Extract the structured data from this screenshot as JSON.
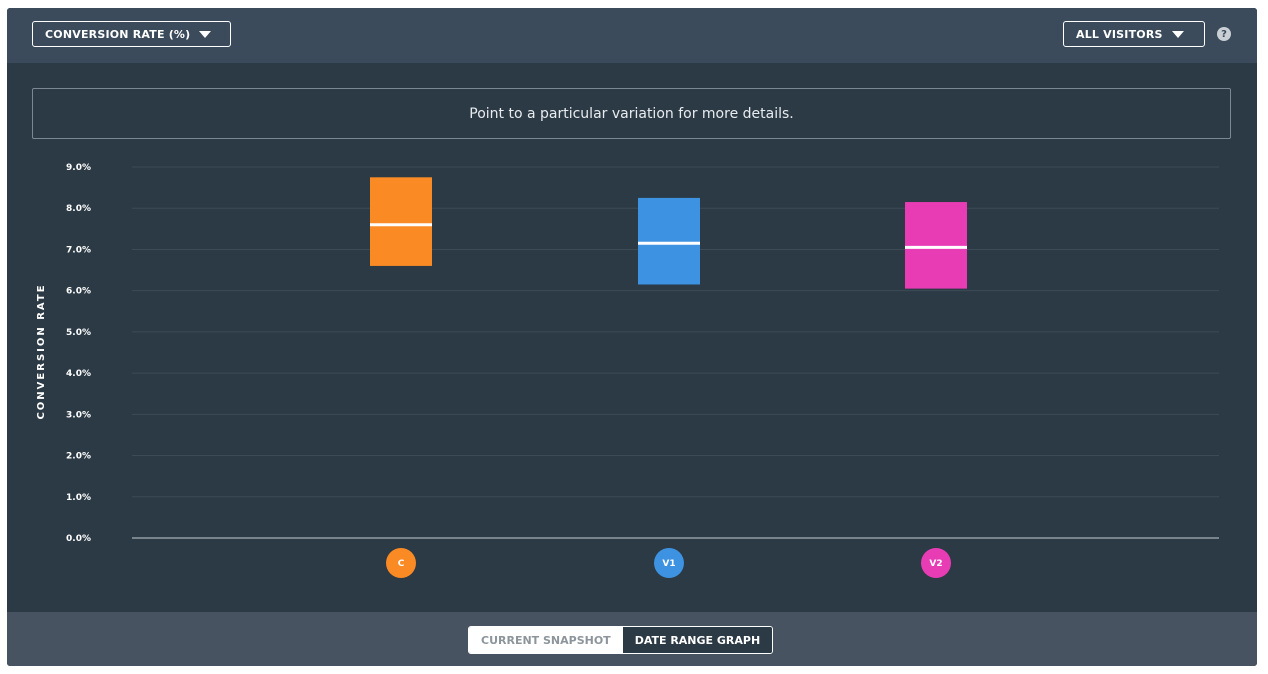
{
  "header": {
    "metric_dropdown": "CONVERSION RATE (%)",
    "segment_dropdown": "ALL VISITORS",
    "help_glyph": "?"
  },
  "hint_text": "Point to a particular variation for more details.",
  "footer": {
    "current_snapshot": "CURRENT SNAPSHOT",
    "date_range_graph": "DATE RANGE GRAPH"
  },
  "chart_data": {
    "type": "box",
    "ylabel": "CONVERSION RATE",
    "ylim": [
      0,
      9
    ],
    "yticks": [
      "0.0%",
      "1.0%",
      "2.0%",
      "3.0%",
      "4.0%",
      "5.0%",
      "6.0%",
      "7.0%",
      "8.0%",
      "9.0%"
    ],
    "grid": true,
    "series": [
      {
        "name": "C",
        "low": 6.6,
        "mid": 7.6,
        "high": 8.75,
        "color": "#f98a24"
      },
      {
        "name": "V1",
        "low": 6.15,
        "mid": 7.15,
        "high": 8.25,
        "color": "#3d92e1"
      },
      {
        "name": "V2",
        "low": 6.05,
        "mid": 7.05,
        "high": 8.15,
        "color": "#e83cb5"
      }
    ]
  }
}
